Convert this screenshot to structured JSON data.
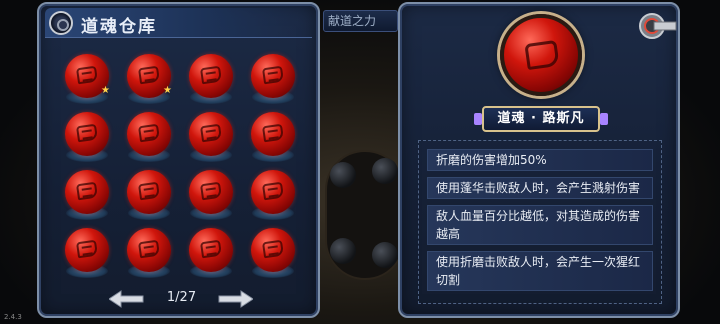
{
  "background": {
    "tab_text": "献道之力"
  },
  "warehouse": {
    "title": "道魂仓库",
    "slots": [
      {
        "star": true
      },
      {
        "star": true
      },
      {
        "star": false
      },
      {
        "star": false
      },
      {
        "star": false
      },
      {
        "star": false
      },
      {
        "star": false
      },
      {
        "star": false
      },
      {
        "star": false
      },
      {
        "star": false
      },
      {
        "star": false
      },
      {
        "star": false
      },
      {
        "star": false
      },
      {
        "star": false
      },
      {
        "star": false
      },
      {
        "star": false
      }
    ],
    "star_glyph": "★",
    "page_indicator": "1/27"
  },
  "detail": {
    "name": "道魂 · 路斯凡",
    "descriptions": [
      "折磨的伤害增加50%",
      "使用蓬华击败敌人时，会产生溅射伤害",
      "敌人血量百分比越低，对其造成的伤害越高",
      "使用折磨击败敌人时，会产生一次猩红切割"
    ]
  },
  "version_label": "2.4.3",
  "colors": {
    "orb_red": "#d0160c",
    "panel_border": "#7d8fa8",
    "star": "#ffd34a",
    "name_border": "#d8c28c"
  }
}
